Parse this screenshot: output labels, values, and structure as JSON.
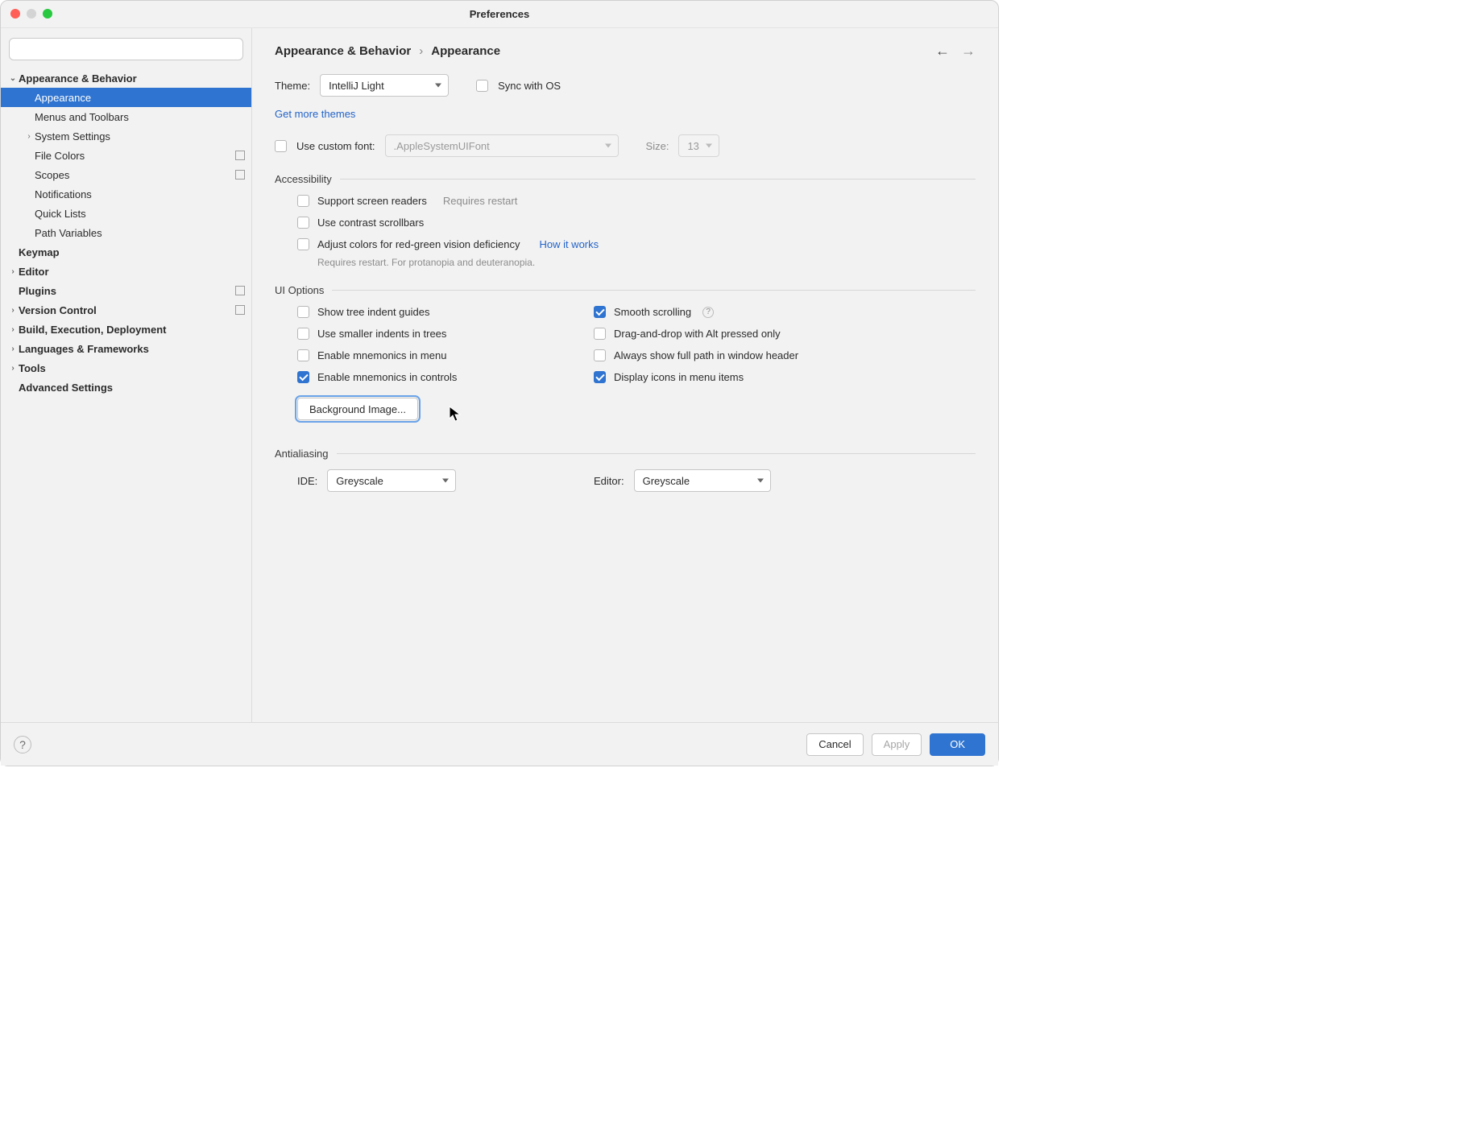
{
  "window": {
    "title": "Preferences"
  },
  "sidebar": {
    "search_placeholder": "",
    "items": [
      {
        "label": "Appearance & Behavior",
        "depth": 0,
        "bold": true,
        "twisty": "down"
      },
      {
        "label": "Appearance",
        "depth": 1,
        "selected": true
      },
      {
        "label": "Menus and Toolbars",
        "depth": 1
      },
      {
        "label": "System Settings",
        "depth": 1,
        "twisty": "right"
      },
      {
        "label": "File Colors",
        "depth": 1,
        "proj": true
      },
      {
        "label": "Scopes",
        "depth": 1,
        "proj": true
      },
      {
        "label": "Notifications",
        "depth": 1
      },
      {
        "label": "Quick Lists",
        "depth": 1
      },
      {
        "label": "Path Variables",
        "depth": 1
      },
      {
        "label": "Keymap",
        "depth": 0,
        "bold": true
      },
      {
        "label": "Editor",
        "depth": 0,
        "bold": true,
        "twisty": "right"
      },
      {
        "label": "Plugins",
        "depth": 0,
        "bold": true,
        "proj": true
      },
      {
        "label": "Version Control",
        "depth": 0,
        "bold": true,
        "twisty": "right",
        "proj": true
      },
      {
        "label": "Build, Execution, Deployment",
        "depth": 0,
        "bold": true,
        "twisty": "right"
      },
      {
        "label": "Languages & Frameworks",
        "depth": 0,
        "bold": true,
        "twisty": "right"
      },
      {
        "label": "Tools",
        "depth": 0,
        "bold": true,
        "twisty": "right"
      },
      {
        "label": "Advanced Settings",
        "depth": 0,
        "bold": true
      }
    ]
  },
  "breadcrumb": {
    "parent": "Appearance & Behavior",
    "current": "Appearance"
  },
  "theme": {
    "label": "Theme:",
    "value": "IntelliJ Light",
    "sync_label": "Sync with OS",
    "sync_checked": false,
    "more_link": "Get more themes"
  },
  "font": {
    "use_custom_label": "Use custom font:",
    "use_custom_checked": false,
    "font_value": ".AppleSystemUIFont",
    "size_label": "Size:",
    "size_value": "13"
  },
  "accessibility": {
    "title": "Accessibility",
    "screen_readers": {
      "label": "Support screen readers",
      "checked": false,
      "hint": "Requires restart"
    },
    "contrast_scroll": {
      "label": "Use contrast scrollbars",
      "checked": false
    },
    "color_deficiency": {
      "label": "Adjust colors for red-green vision deficiency",
      "checked": false,
      "link": "How it works",
      "hint": "Requires restart. For protanopia and deuteranopia."
    }
  },
  "ui_options": {
    "title": "UI Options",
    "left": [
      {
        "key": "tree_indent",
        "label": "Show tree indent guides",
        "checked": false
      },
      {
        "key": "smaller_indents",
        "label": "Use smaller indents in trees",
        "checked": false
      },
      {
        "key": "mnemonics_menu",
        "label": "Enable mnemonics in menu",
        "checked": false
      },
      {
        "key": "mnemonics_controls",
        "label": "Enable mnemonics in controls",
        "checked": true
      }
    ],
    "right": [
      {
        "key": "smooth_scroll",
        "label": "Smooth scrolling",
        "checked": true,
        "help": true
      },
      {
        "key": "dnd_alt",
        "label": "Drag-and-drop with Alt pressed only",
        "checked": false
      },
      {
        "key": "full_path",
        "label": "Always show full path in window header",
        "checked": false
      },
      {
        "key": "icons_menu",
        "label": "Display icons in menu items",
        "checked": true
      }
    ],
    "bg_image_btn": "Background Image..."
  },
  "antialiasing": {
    "title": "Antialiasing",
    "ide_label": "IDE:",
    "ide_value": "Greyscale",
    "editor_label": "Editor:",
    "editor_value": "Greyscale"
  },
  "footer": {
    "cancel": "Cancel",
    "apply": "Apply",
    "ok": "OK"
  }
}
